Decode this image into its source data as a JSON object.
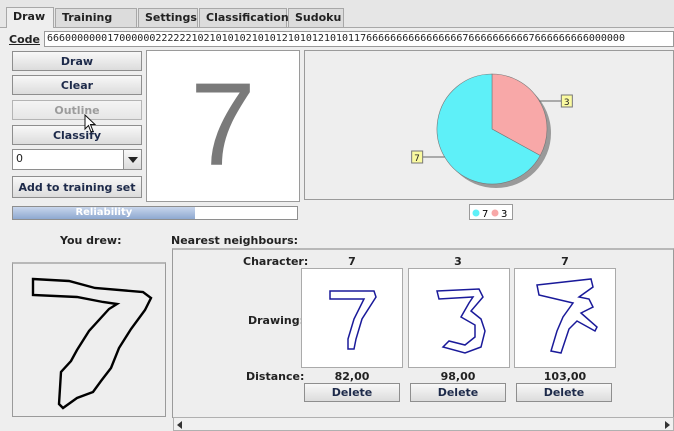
{
  "tabs": [
    "Draw",
    "Training set",
    "Settings",
    "Classification",
    "Sudoku"
  ],
  "active_tab": "Draw",
  "code": {
    "label": "Code",
    "value": "666000000017000000222222102101010210101210101210101176666666666666666766666666667666666666000000"
  },
  "buttons": {
    "draw": "Draw",
    "clear": "Clear",
    "outline": "Outline",
    "classify": "Classify",
    "add_to_training": "Add to training set"
  },
  "select": {
    "value": "0"
  },
  "predicted_digit": "7",
  "reliability": {
    "label": "Reliability",
    "fraction": 0.64
  },
  "pie": {
    "slices": [
      {
        "label": "7",
        "fraction": 0.67,
        "color": "#5ef0f8"
      },
      {
        "label": "3",
        "fraction": 0.33,
        "color": "#f8a8a8"
      }
    ],
    "legend": [
      "7",
      "3"
    ]
  },
  "you_drew_label": "You drew:",
  "nearest_label": "Nearest neighbours:",
  "nn_row_labels": {
    "character": "Character:",
    "drawing": "Drawing:",
    "distance": "Distance:"
  },
  "neighbours": [
    {
      "character": "7",
      "distance": "82,00",
      "delete_label": "Delete"
    },
    {
      "character": "3",
      "distance": "98,00",
      "delete_label": "Delete"
    },
    {
      "character": "7",
      "distance": "103,00",
      "delete_label": "Delete"
    }
  ],
  "colors": {
    "outline_blue": "#0a0a8c",
    "bar_fill": "#9db4d8",
    "accent": "#1d2a4a"
  }
}
